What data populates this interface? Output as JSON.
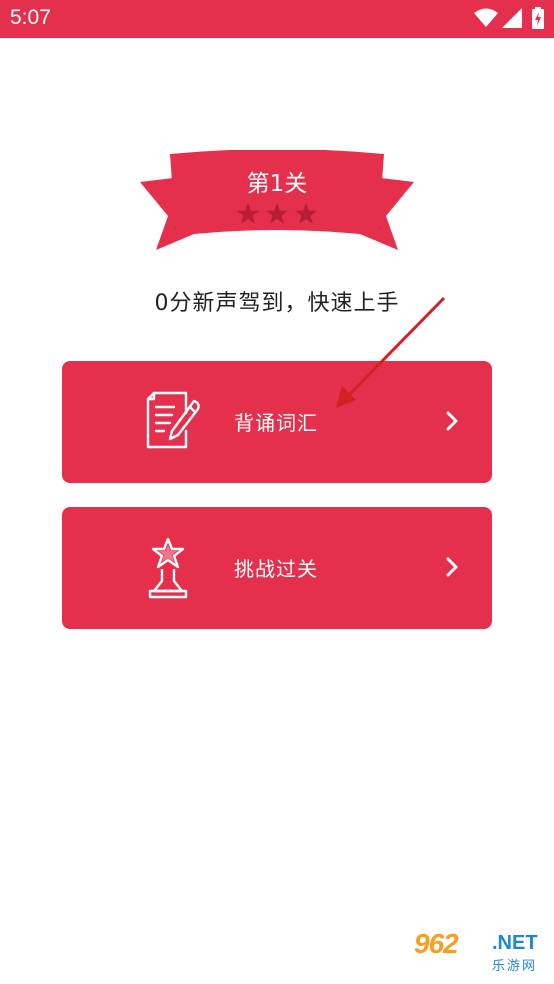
{
  "status_bar": {
    "time": "5:07",
    "icons": [
      "wifi-icon",
      "signal-icon",
      "battery-icon"
    ]
  },
  "level": {
    "title": "第1关",
    "stars_total": 3,
    "stars_earned": 0
  },
  "subtitle": "0分新声驾到，快速上手",
  "actions": [
    {
      "label": "背诵词汇",
      "icon": "document-pen-icon"
    },
    {
      "label": "挑战过关",
      "icon": "star-trophy-icon"
    }
  ],
  "watermark": {
    "main": "962",
    "net": ".NET",
    "sub": "乐游网"
  },
  "colors": {
    "accent": "#e5304d",
    "ribbon_dark": "#c21f3a",
    "star_inactive": "#b81d37",
    "arrow": "#d42020"
  }
}
